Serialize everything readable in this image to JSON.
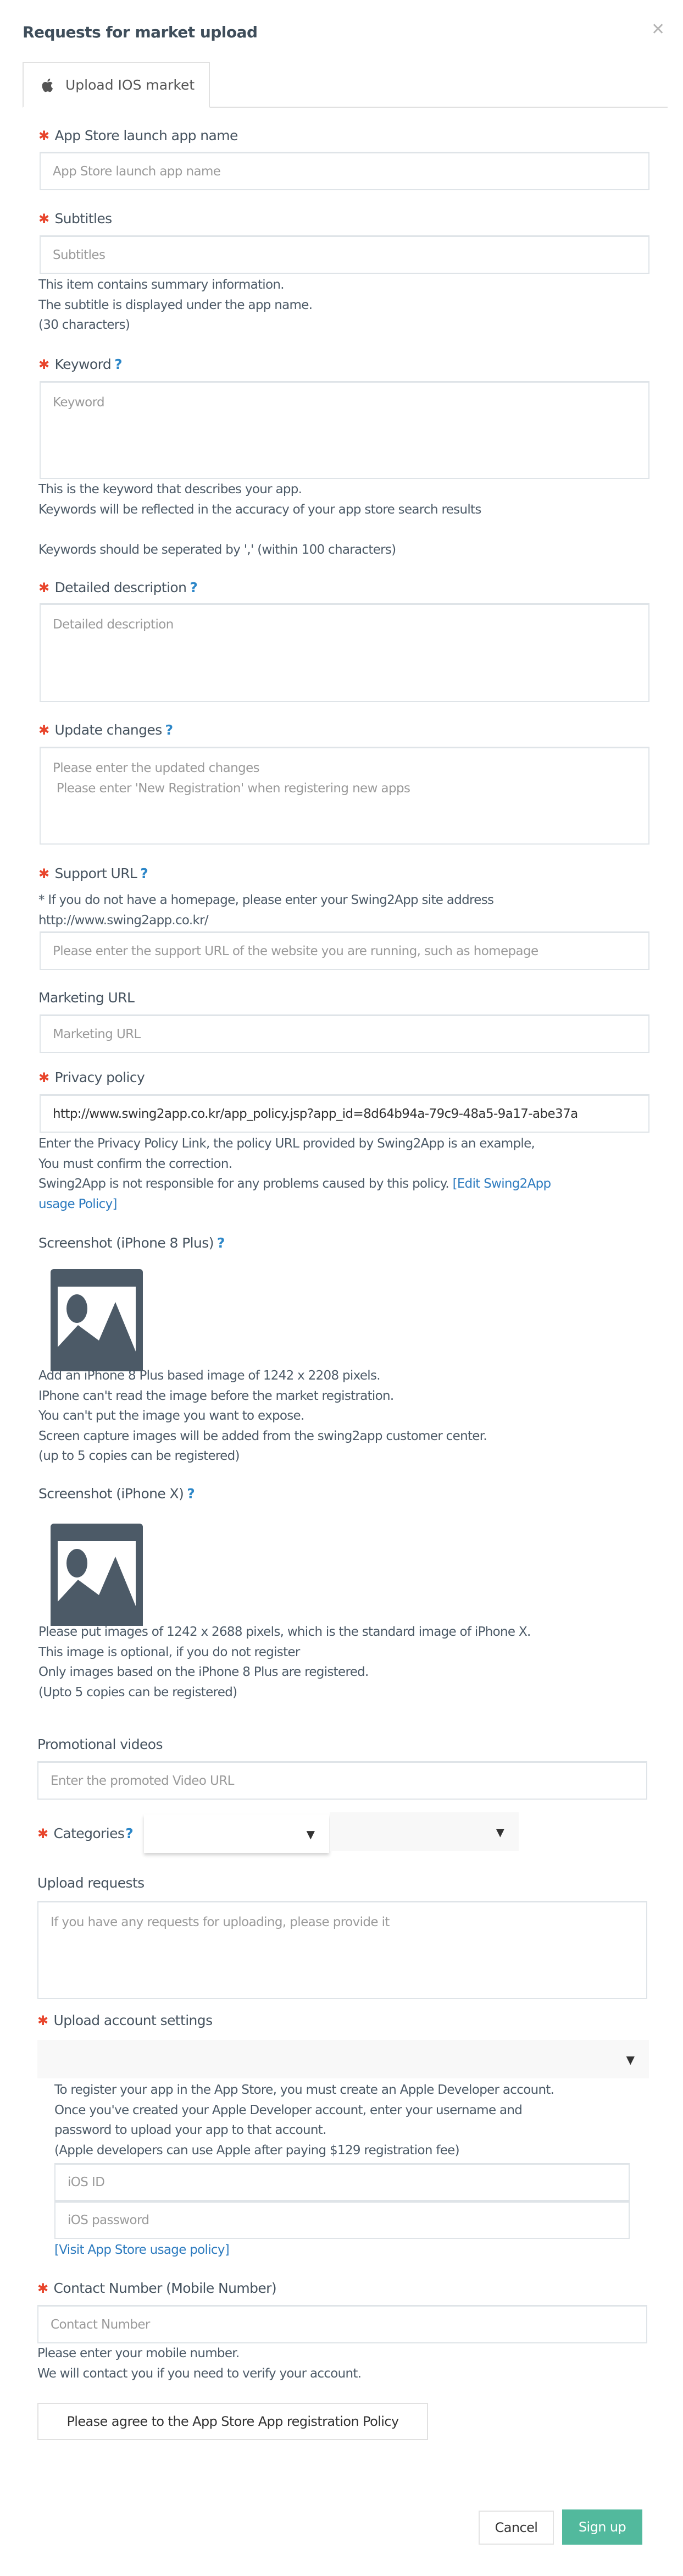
{
  "modal": {
    "title": "Requests for market upload",
    "close_icon": "close-x-icon"
  },
  "tabs": [
    {
      "label": "Upload IOS market",
      "icon": "apple-icon",
      "active": true
    }
  ],
  "fields": {
    "app_name": {
      "label": "App Store launch app name",
      "required": true,
      "placeholder": "App Store launch app name",
      "value": ""
    },
    "subtitles": {
      "label": "Subtitles",
      "required": true,
      "placeholder": "Subtitles",
      "value": "",
      "help": [
        "This item contains summary information.",
        "The subtitle is displayed under the app name.",
        "(30 characters)"
      ]
    },
    "keyword": {
      "label": "Keyword",
      "required": true,
      "has_help_icon": true,
      "placeholder": "Keyword",
      "value": "",
      "help": [
        "This is the keyword that describes your app.",
        "Keywords will be reflected in the accuracy of your app store search results",
        "",
        "Keywords should be seperated by ',' (within 100 characters)"
      ]
    },
    "detailed_description": {
      "label": "Detailed description",
      "required": true,
      "has_help_icon": true,
      "placeholder": "Detailed description",
      "value": ""
    },
    "update_changes": {
      "label": "Update changes",
      "required": true,
      "has_help_icon": true,
      "placeholder": "Please enter the updated changes\n Please enter 'New Registration' when registering new apps",
      "value": ""
    },
    "support_url": {
      "label": "Support URL",
      "required": true,
      "has_help_icon": true,
      "notes": [
        "* If you do not have a homepage, please enter your Swing2App site address",
        "http://www.swing2app.co.kr/"
      ],
      "placeholder": "Please enter the support URL of the website you are running, such as homepage",
      "value": ""
    },
    "marketing_url": {
      "label": "Marketing URL",
      "required": false,
      "placeholder": "Marketing URL",
      "value": ""
    },
    "privacy_policy": {
      "label": "Privacy policy",
      "required": true,
      "value": "http://www.swing2app.co.kr/app_policy.jsp?app_id=8d64b94a-79c9-48a5-9a17-abe37a",
      "help": [
        "Enter the Privacy Policy Link, the policy URL provided by Swing2App is an example,",
        "You must confirm the correction.",
        "Swing2App is not responsible for any problems caused by this policy. "
      ],
      "link_label_1": "[Edit Swing2App",
      "link_label_2": "usage Policy]"
    },
    "screenshot_8plus": {
      "label": "Screenshot (iPhone 8 Plus)",
      "has_help_icon": true,
      "image_icon": "image-placeholder-icon",
      "help": [
        "Add an iPhone 8 Plus based image of 1242 x 2208 pixels.",
        "IPhone can't read the image before the market registration.",
        "You can't put the image you want to expose.",
        "Screen capture images will be added from the swing2app customer center.",
        "(up to 5 copies can be registered)"
      ]
    },
    "screenshot_x": {
      "label": "Screenshot (iPhone X)",
      "has_help_icon": true,
      "image_icon": "image-placeholder-icon",
      "help": [
        "Please put images of 1242 x 2688 pixels, which is the standard image of iPhone X.",
        "This image is optional, if you do not register",
        "Only images based on the iPhone 8 Plus are registered.",
        "(Upto 5 copies can be registered)"
      ]
    },
    "promotional_videos": {
      "label": "Promotional videos",
      "placeholder": "Enter the promoted Video URL",
      "value": ""
    },
    "categories": {
      "label": "Categories",
      "required": true,
      "has_help_icon": true,
      "primary_value": "",
      "secondary_value": ""
    },
    "upload_requests": {
      "label": "Upload requests",
      "placeholder": "If you have any requests for uploading, please provide it",
      "value": ""
    },
    "upload_account": {
      "label": "Upload account settings",
      "required": true,
      "selected": "",
      "help": [
        "To register your app in the App Store, you must create an Apple Developer account.",
        "Once you've created your Apple Developer account, enter your username and",
        "password to upload your app to that account.",
        "(Apple developers can use Apple after paying $129 registration fee)"
      ],
      "ios_id_placeholder": "iOS ID",
      "ios_password_placeholder": "iOS password",
      "policy_link": "[Visit App Store usage policy]"
    },
    "contact_number": {
      "label": "Contact Number (Mobile Number)",
      "required": true,
      "placeholder": "Contact Number",
      "value": "",
      "help": [
        "Please enter your mobile number.",
        "We will contact you if you need to verify your account."
      ]
    }
  },
  "required_mark": "✱",
  "help_mark": "?",
  "dropdown_arrow": "▼",
  "buttons": {
    "agree": "Please agree to the App Store App registration Policy",
    "cancel": "Cancel",
    "signup": "Sign up"
  },
  "colors": {
    "accent": "#52b99d",
    "required": "#e8452c",
    "link": "#2d7bbf",
    "help_icon": "#2d87c8",
    "text": "#4c5a67"
  }
}
